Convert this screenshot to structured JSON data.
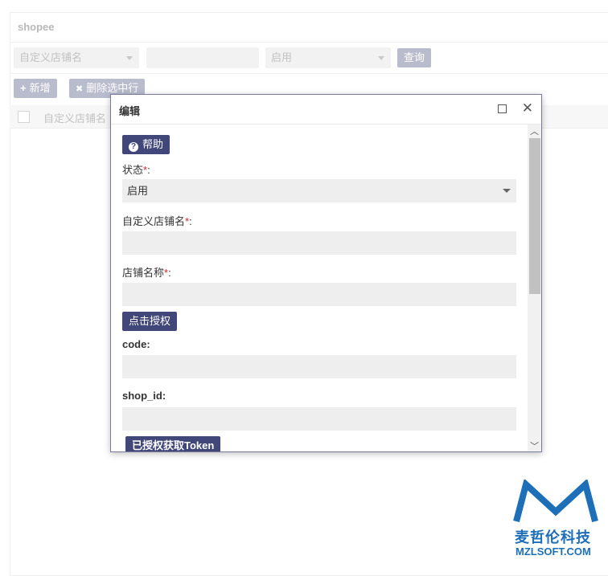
{
  "page": {
    "title": "shopee",
    "filters": {
      "shop_name_placeholder": "自定义店铺名",
      "status_value": "启用",
      "query_label": "查询"
    },
    "toolbar": {
      "add_icon": "+",
      "add_label": "新增",
      "delete_icon": "✖",
      "delete_label": "删除选中行"
    },
    "grid": {
      "columns": [
        "自定义店铺名"
      ]
    }
  },
  "dialog": {
    "title": "编辑",
    "help_label": "帮助",
    "fields": {
      "status_label": "状态",
      "status_value": "启用",
      "custom_name_label": "自定义店铺名",
      "shop_name_label": "店铺名称",
      "code_label": "code",
      "shop_id_label": "shop_id"
    },
    "required_mark": "*",
    "colon": ":",
    "authorize_label": "点击授权",
    "token_label": "已授权获取Token"
  },
  "watermark": {
    "brand_cn": "麦哲伦科技",
    "brand_en": "MZLSOFT.COM"
  },
  "colors": {
    "primary": "#414778",
    "disabled_btn": "#b9bccd",
    "required": "#e02020",
    "brand": "#1d6fb8"
  }
}
